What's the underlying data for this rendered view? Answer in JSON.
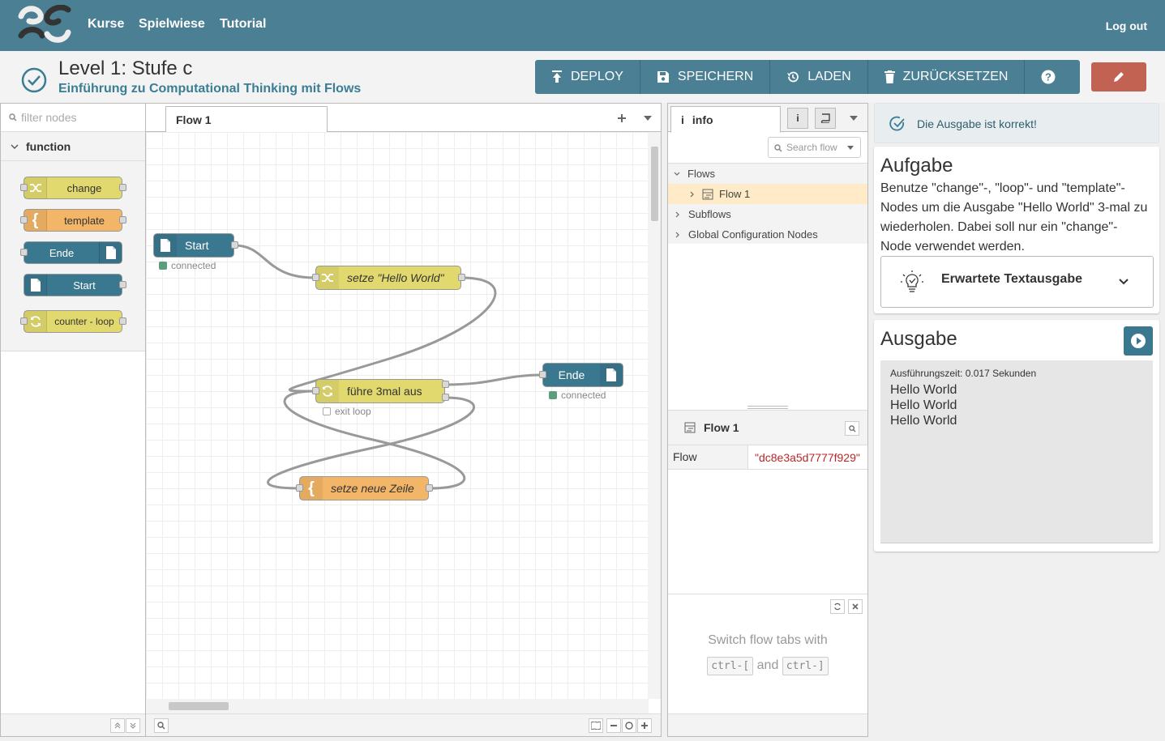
{
  "nav": {
    "items": [
      "Kurse",
      "Spielwiese",
      "Tutorial"
    ],
    "logout": "Log out"
  },
  "level": {
    "title": "Level 1: Stufe c",
    "subtitle": "Einführung zu Computational Thinking mit Flows"
  },
  "toolbar": {
    "deploy": "DEPLOY",
    "save": "SPEICHERN",
    "load": "LADEN",
    "reset": "ZURÜCKSETZEN"
  },
  "palette": {
    "filter_placeholder": "filter nodes",
    "category": "function",
    "nodes": [
      "change",
      "template",
      "Ende",
      "Start",
      "counter - loop"
    ]
  },
  "workspace": {
    "tab": "Flow 1",
    "nodes": {
      "start": "Start",
      "change": "setze \"Hello World\"",
      "loop": "führe 3mal aus",
      "ende": "Ende",
      "template": "setze neue Zeile"
    },
    "status": {
      "start": "connected",
      "ende": "connected",
      "loop": "exit loop"
    }
  },
  "sidebar": {
    "tab": "info",
    "search_placeholder": "Search flow",
    "tree": {
      "flows": "Flows",
      "flow1": "Flow 1",
      "subflows": "Subflows",
      "global": "Global Configuration Nodes"
    },
    "info_title": "Flow 1",
    "info_key": "Flow",
    "info_value": "\"dc8e3a5d7777f929\"",
    "help_text": "Switch flow tabs with",
    "help_key1": "ctrl-[",
    "help_and": "and",
    "help_key2": "ctrl-]"
  },
  "task": {
    "alert": "Die Ausgabe ist korrekt!",
    "aufgabe_title": "Aufgabe",
    "aufgabe_text": "Benutze \"change\"-, \"loop\"- und \"template\"-Nodes um die Ausgabe \"Hello World\" 3-mal zu wiederholen. Dabei soll nur ein \"change\"-Node verwendet werden.",
    "expected_label": "Erwartete Textausgabe",
    "ausgabe_title": "Ausgabe",
    "exec_time": "Ausführungszeit: 0.017 Sekunden",
    "output_lines": [
      "Hello World",
      "Hello World",
      "Hello World"
    ]
  },
  "colors": {
    "header": "#4a7f94",
    "change": "#e2d96e",
    "template": "#f3b567",
    "file": "#3a7890",
    "edit": "#c26253"
  }
}
